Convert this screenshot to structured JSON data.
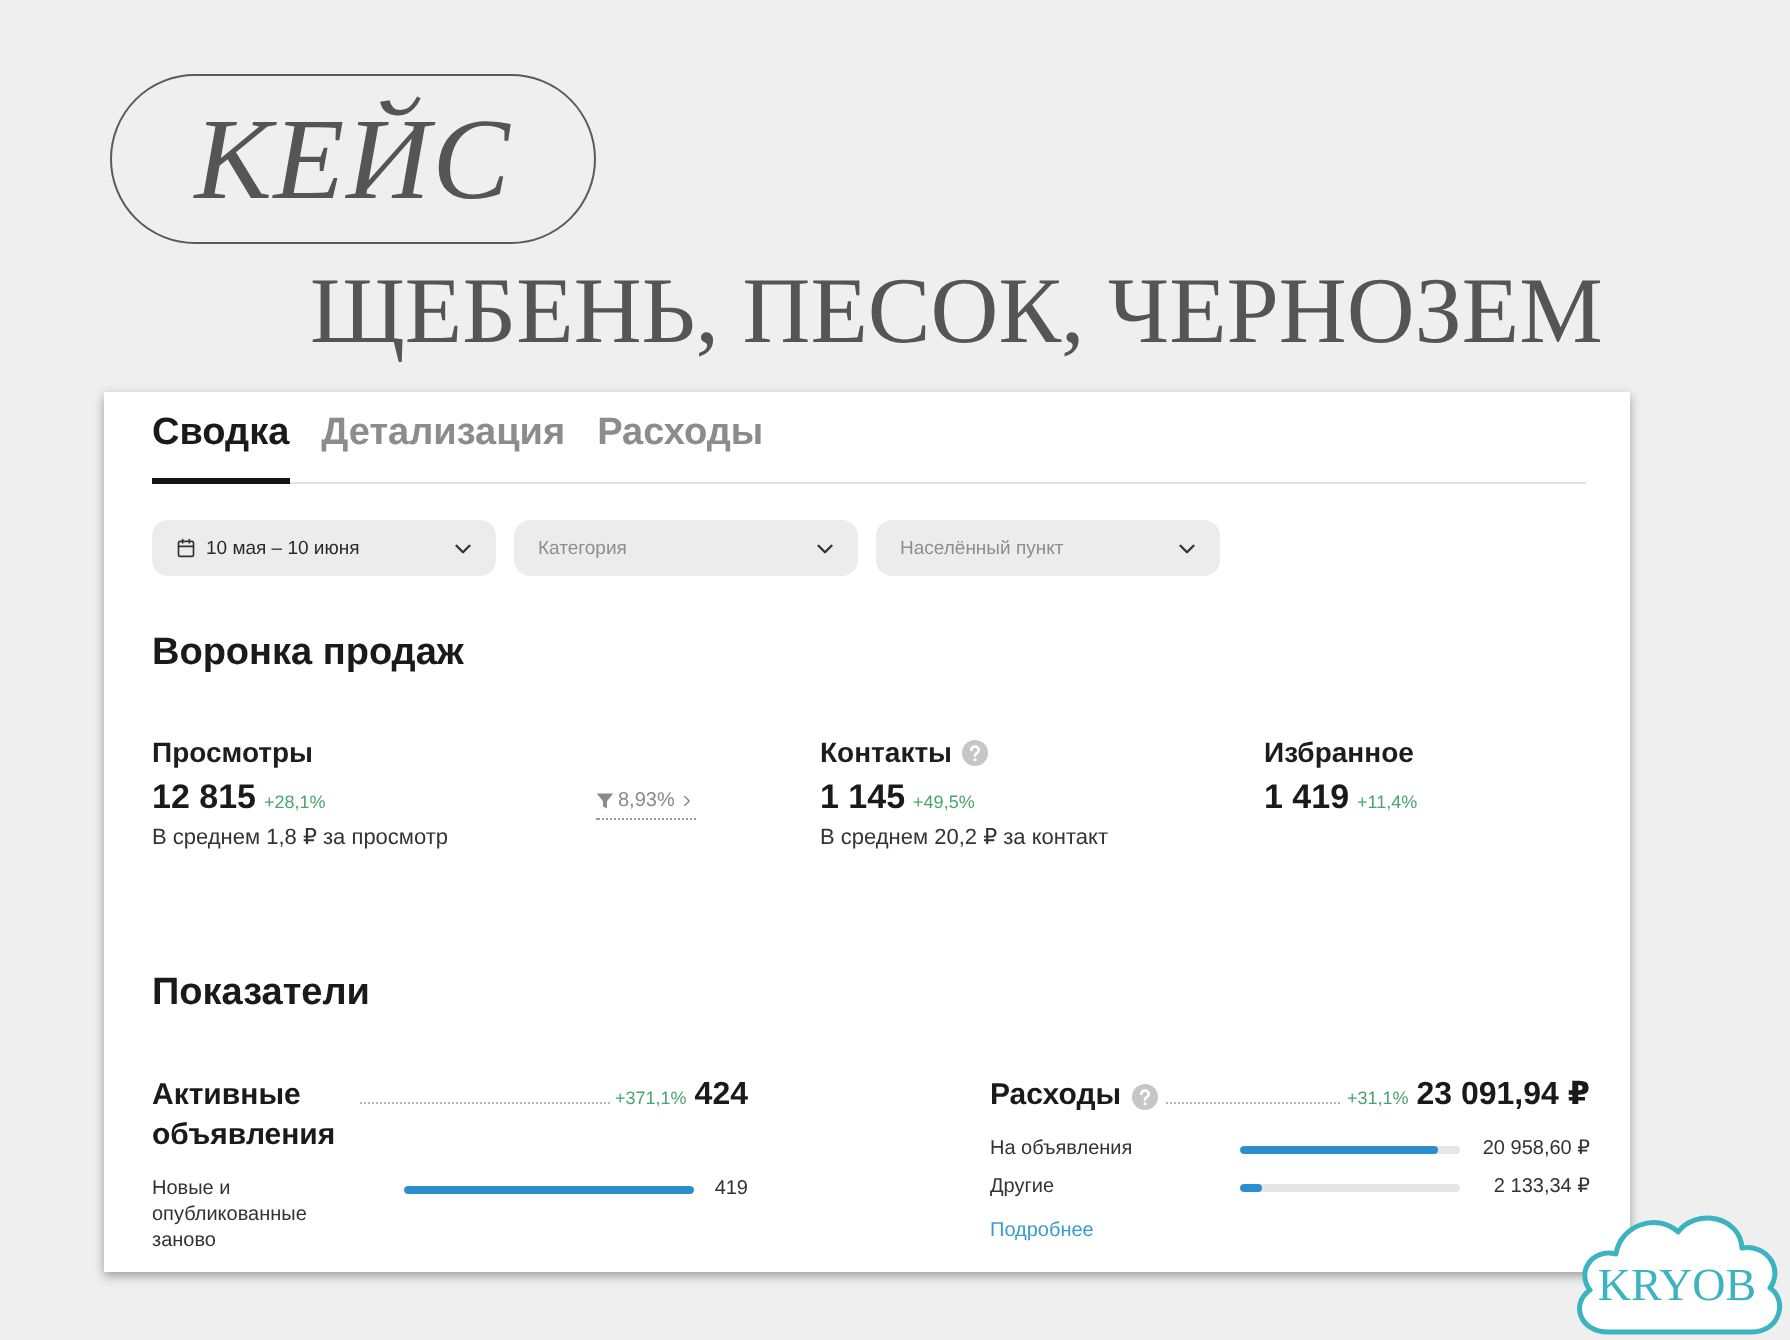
{
  "case_badge": {
    "text": "КЕЙС"
  },
  "title": "ЩЕБЕНЬ, ПЕСОК, ЧЕРНОЗЕМ",
  "dashboard": {
    "tabs": [
      {
        "label": "Сводка",
        "selected": true
      },
      {
        "label": "Детализация",
        "selected": false
      },
      {
        "label": "Расходы",
        "selected": false
      }
    ],
    "filters": [
      {
        "kind": "date",
        "value": "10 мая – 10 июня"
      },
      {
        "kind": "select",
        "placeholder": "Категория"
      },
      {
        "kind": "select",
        "placeholder": "Населённый пункт"
      }
    ],
    "funnel": {
      "title": "Воронка продаж",
      "items": [
        {
          "kind": "stage",
          "label": "Просмотры",
          "info": false,
          "value": "12 815",
          "change": "+28,1%",
          "note": "В среднем 1,8 ₽ за просмотр"
        },
        {
          "kind": "conversion",
          "value": "8,93%"
        },
        {
          "kind": "stage",
          "label": "Контакты",
          "info": true,
          "value": "1 145",
          "change": "+49,5%",
          "note": "В среднем 20,2 ₽ за контакт"
        },
        {
          "kind": "stage",
          "label": "Избранное",
          "info": false,
          "value": "1 419",
          "change": "+11,4%"
        }
      ]
    },
    "indicators": {
      "title": "Показатели",
      "blocks": [
        {
          "label": "Активные объявления",
          "info": false,
          "change": "+371,1%",
          "total": "424",
          "rows": [
            {
              "label": "Новые и опубликованные заново",
              "level": 1,
              "value": "419"
            }
          ]
        },
        {
          "label": "Расходы",
          "info": true,
          "change": "+31,1%",
          "total": "23 091,94 ₽",
          "rows": [
            {
              "label": "На объявления",
              "level": 0.9,
              "value": "20 958,60 ₽"
            },
            {
              "label": "Другие",
              "level": 0.1,
              "value": "2 133,34 ₽"
            }
          ],
          "link": "Подробнее"
        }
      ]
    }
  },
  "logo": {
    "text": "KRYOB"
  }
}
